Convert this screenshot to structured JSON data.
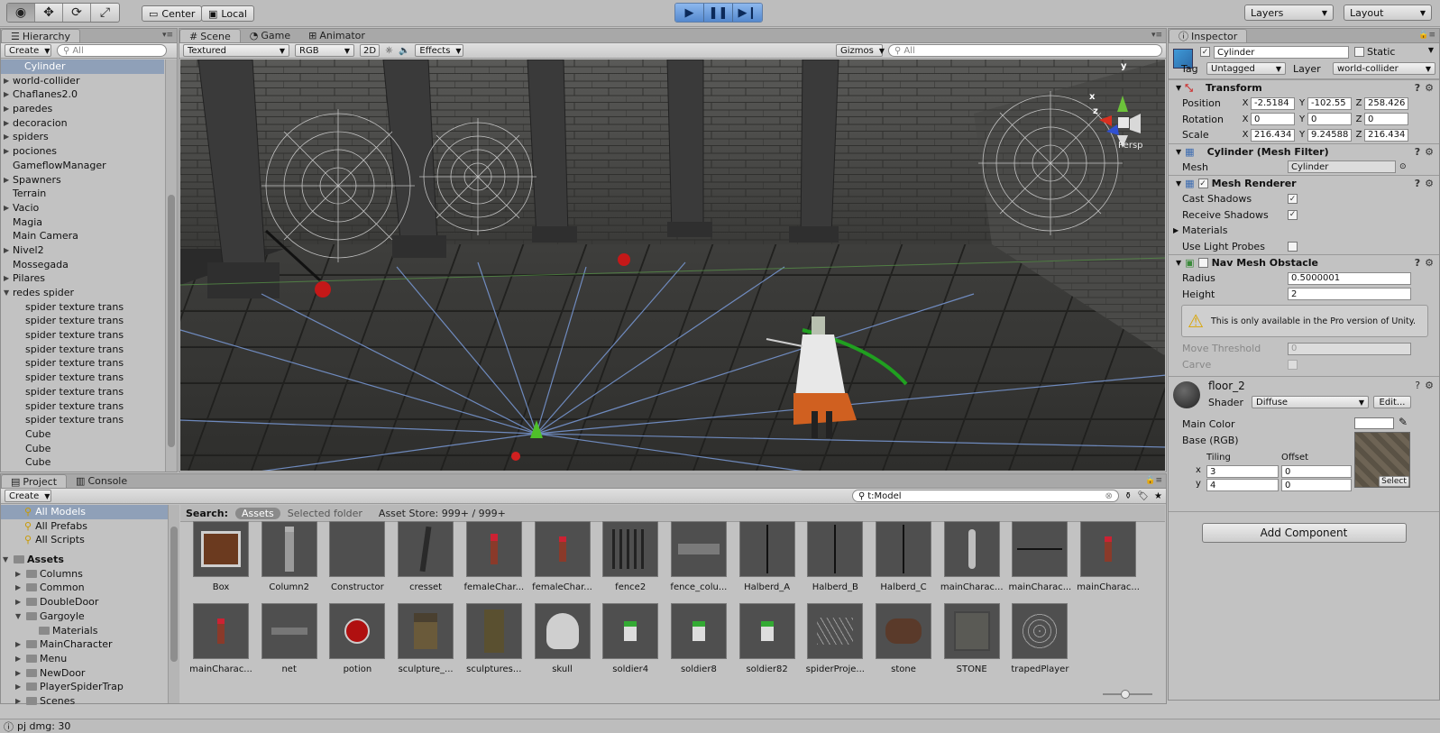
{
  "toolbar": {
    "tools": [
      "view-tool",
      "move-tool",
      "rotate-tool",
      "scale-tool"
    ],
    "pivot_label": "Center",
    "space_label": "Local",
    "play_controls": [
      "play",
      "pause",
      "step"
    ],
    "layers_label": "Layers",
    "layout_label": "Layout"
  },
  "hierarchy": {
    "tab_label": "Hierarchy",
    "create_label": "Create",
    "search_placeholder": "All",
    "items": [
      {
        "label": "Cylinder",
        "selected": true
      },
      {
        "label": "world-collider",
        "arrow": "right"
      },
      {
        "label": "Chaflanes2.0",
        "arrow": "right"
      },
      {
        "label": "paredes",
        "arrow": "right"
      },
      {
        "label": "decoracion",
        "arrow": "right"
      },
      {
        "label": "spiders",
        "arrow": "right"
      },
      {
        "label": "pociones",
        "arrow": "right"
      },
      {
        "label": "GameflowManager"
      },
      {
        "label": "Spawners",
        "arrow": "right"
      },
      {
        "label": "Terrain"
      },
      {
        "label": "Vacio",
        "arrow": "right"
      },
      {
        "label": "Magia"
      },
      {
        "label": "Main Camera"
      },
      {
        "label": "Nivel2",
        "arrow": "right"
      },
      {
        "label": "Mossegada"
      },
      {
        "label": "Pilares",
        "arrow": "right"
      },
      {
        "label": "redes spider",
        "arrow": "down"
      },
      {
        "label": "spider texture trans",
        "child": true
      },
      {
        "label": "spider texture trans",
        "child": true
      },
      {
        "label": "spider texture trans",
        "child": true
      },
      {
        "label": "spider texture trans",
        "child": true
      },
      {
        "label": "spider texture trans",
        "child": true
      },
      {
        "label": "spider texture trans",
        "child": true
      },
      {
        "label": "spider texture trans",
        "child": true
      },
      {
        "label": "spider texture trans",
        "child": true
      },
      {
        "label": "spider texture trans",
        "child": true
      },
      {
        "label": "Cube",
        "child": true
      },
      {
        "label": "Cube",
        "child": true
      },
      {
        "label": "Cube",
        "child": true
      }
    ]
  },
  "scene": {
    "tabs": [
      "Scene",
      "Game",
      "Animator"
    ],
    "shading_mode": "Textured",
    "render_mode": "RGB",
    "mode_2d": "2D",
    "effects_label": "Effects",
    "gizmos_label": "Gizmos",
    "search_placeholder": "All",
    "persp_label": "Persp",
    "axis_labels": {
      "x": "x",
      "y": "y",
      "z": "z"
    }
  },
  "inspector": {
    "tab_label": "Inspector",
    "object_name": "Cylinder",
    "static_label": "Static",
    "tag_label": "Tag",
    "tag_value": "Untagged",
    "layer_label": "Layer",
    "layer_value": "world-collider",
    "transform": {
      "title": "Transform",
      "position_label": "Position",
      "rotation_label": "Rotation",
      "scale_label": "Scale",
      "position": [
        "-2.5184",
        "-102.55",
        "258.426"
      ],
      "rotation": [
        "0",
        "0",
        "0"
      ],
      "scale": [
        "216.434",
        "9.24588",
        "216.434"
      ]
    },
    "mesh_filter": {
      "title": "Cylinder (Mesh Filter)",
      "mesh_label": "Mesh",
      "mesh_value": "Cylinder"
    },
    "mesh_renderer": {
      "title": "Mesh Renderer",
      "cast_shadows_label": "Cast Shadows",
      "receive_shadows_label": "Receive Shadows",
      "materials_label": "Materials",
      "light_probes_label": "Use Light Probes"
    },
    "nav_mesh_obstacle": {
      "title": "Nav Mesh Obstacle",
      "radius_label": "Radius",
      "radius_value": "0.5000001",
      "height_label": "Height",
      "height_value": "2",
      "warning": "This is only available in the Pro version of Unity.",
      "move_threshold_label": "Move Threshold",
      "move_threshold_value": "0",
      "carve_label": "Carve"
    },
    "material": {
      "name": "floor_2",
      "shader_label": "Shader",
      "shader_value": "Diffuse",
      "edit_label": "Edit...",
      "main_color_label": "Main Color",
      "base_label": "Base (RGB)",
      "tiling_label": "Tiling",
      "offset_label": "Offset",
      "x_label": "x",
      "y_label": "y",
      "tiling_x": "3",
      "tiling_y": "4",
      "offset_x": "0",
      "offset_y": "0",
      "select_label": "Select"
    },
    "add_component_label": "Add Component"
  },
  "project": {
    "tabs": [
      "Project",
      "Console"
    ],
    "create_label": "Create",
    "search_value": "t:Model",
    "favorites": [
      "All Models",
      "All Prefabs",
      "All Scripts"
    ],
    "tree": [
      {
        "label": "Assets",
        "bold": true,
        "arrow": "down",
        "depth": 0
      },
      {
        "label": "Columns",
        "arrow": "right",
        "depth": 1
      },
      {
        "label": "Common",
        "arrow": "right",
        "depth": 1
      },
      {
        "label": "DoubleDoor",
        "arrow": "right",
        "depth": 1
      },
      {
        "label": "Gargoyle",
        "arrow": "down",
        "depth": 1
      },
      {
        "label": "Materials",
        "depth": 2
      },
      {
        "label": "MainCharacter",
        "arrow": "right",
        "depth": 1
      },
      {
        "label": "Menu",
        "arrow": "right",
        "depth": 1
      },
      {
        "label": "NewDoor",
        "arrow": "right",
        "depth": 1
      },
      {
        "label": "PlayerSpiderTrap",
        "arrow": "right",
        "depth": 1
      },
      {
        "label": "Scenes",
        "arrow": "right",
        "depth": 1
      }
    ],
    "search_label": "Search:",
    "search_scopes": [
      "Assets",
      "Selected folder"
    ],
    "asset_store_label": "Asset Store: 999+ / 999+",
    "assets": [
      "Box",
      "Column2",
      "Constructor",
      "cresset",
      "femaleChar...",
      "femaleChar...",
      "fence2",
      "fence_colu...",
      "Halberd_A",
      "Halberd_B",
      "Halberd_C",
      "mainCharac...",
      "mainCharac...",
      "mainCharac...",
      "mainCharac...",
      "net",
      "potion",
      "sculpture_...",
      "sculptures...",
      "skull",
      "soldier4",
      "soldier8",
      "soldier82",
      "spiderProje...",
      "stone",
      "STONE",
      "trapedPlayer"
    ]
  },
  "status": {
    "message": "pj dmg: 30"
  },
  "colors": {
    "play_blue": "#5589cf",
    "selection": "#8fa0b8",
    "panel_bg": "#c2c2c2"
  }
}
